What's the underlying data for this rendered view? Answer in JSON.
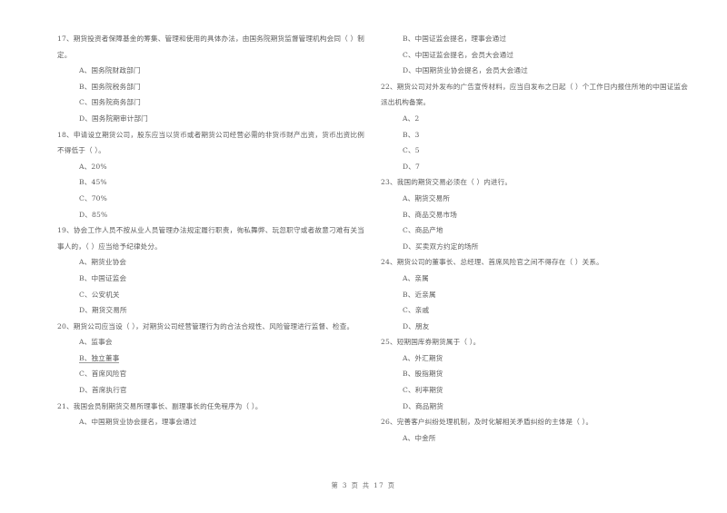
{
  "document": {
    "page_footer": "第 3 页 共 17 页",
    "page_number": "3",
    "total_pages": "17"
  },
  "columns": [
    {
      "id": "left-column",
      "questions": [
        {
          "number": "17",
          "stem": "17、期货投资者保障基金的筹集、管理和使用的具体办法，由国务院期货监督管理机构会同（    ）制定。",
          "options": [
            {
              "label": "A、国务院财政部门",
              "underlined": false
            },
            {
              "label": "B、国务院税务部门",
              "underlined": false
            },
            {
              "label": "C、国务院商务部门",
              "underlined": false
            },
            {
              "label": "D、国务院期审计部门",
              "underlined": false
            }
          ]
        },
        {
          "number": "18",
          "stem": "18、申请设立期货公司，股东应当以货币或者期货公司经营必需的非货币财产出资，货币出资比例不得低于（    ）。",
          "options": [
            {
              "label": "A、20%",
              "underlined": false
            },
            {
              "label": "B、45%",
              "underlined": false
            },
            {
              "label": "C、70%",
              "underlined": false
            },
            {
              "label": "D、85%",
              "underlined": false
            }
          ]
        },
        {
          "number": "19",
          "stem": "19、协会工作人员不按从业人员管理办法规定履行职责，徇私舞弊、玩忽职守或者故意刁难有关当事人的，（    ）应当给予纪律处分。",
          "options": [
            {
              "label": "A、期货业协会",
              "underlined": false
            },
            {
              "label": "B、中国证监会",
              "underlined": false
            },
            {
              "label": "C、公安机关",
              "underlined": false
            },
            {
              "label": "D、期货交易所",
              "underlined": false
            }
          ]
        },
        {
          "number": "20",
          "stem": "20、期货公司应当设（    ），对期货公司经营管理行为的合法合规性、风险管理进行监督、检查。",
          "options": [
            {
              "label": "A、监事会",
              "underlined": false
            },
            {
              "label": "B、独立董事",
              "underlined": true
            },
            {
              "label": "C、首席风险官",
              "underlined": false
            },
            {
              "label": "D、首席执行官",
              "underlined": false
            }
          ]
        },
        {
          "number": "21",
          "stem": "21、我国会员制期货交易所理事长、副理事长的任免程序为（    ）。",
          "options": [
            {
              "label": "A、中国期货业协会提名，理事会通过",
              "underlined": false
            }
          ]
        }
      ]
    },
    {
      "id": "right-column",
      "questions": [
        {
          "number": "21-cont",
          "stem": "",
          "options": [
            {
              "label": "B、中国证监会提名，理事会通过",
              "underlined": false
            },
            {
              "label": "C、中国证监会提名，会员大会通过",
              "underlined": false
            },
            {
              "label": "D、中国期货业协会提名，会员大会通过",
              "underlined": false
            }
          ]
        },
        {
          "number": "22",
          "stem": "22、期货公司对外发布的广告宣传材料，应当自发布之日起（    ）个工作日内报住所地的中国证监会派出机构备案。",
          "options": [
            {
              "label": "A、2",
              "underlined": false
            },
            {
              "label": "B、3",
              "underlined": false
            },
            {
              "label": "C、5",
              "underlined": false
            },
            {
              "label": "D、7",
              "underlined": false
            }
          ]
        },
        {
          "number": "23",
          "stem": "23、我国的期货交易必须在（    ）内进行。",
          "options": [
            {
              "label": "A、期货交易所",
              "underlined": false
            },
            {
              "label": "B、商品交易市场",
              "underlined": false
            },
            {
              "label": "C、商品产地",
              "underlined": false
            },
            {
              "label": "D、买卖双方约定的场所",
              "underlined": false
            }
          ]
        },
        {
          "number": "24",
          "stem": "24、期货公司的董事长、总经理、首席风险官之间不得存在（    ）关系。",
          "options": [
            {
              "label": "A、亲属",
              "underlined": false
            },
            {
              "label": "B、近亲属",
              "underlined": false
            },
            {
              "label": "C、亲戚",
              "underlined": false
            },
            {
              "label": "D、朋友",
              "underlined": false
            }
          ]
        },
        {
          "number": "25",
          "stem": "25、短期国库券期货属于（    ）。",
          "options": [
            {
              "label": "A、外汇期货",
              "underlined": false
            },
            {
              "label": "B、股指期货",
              "underlined": false
            },
            {
              "label": "C、利率期货",
              "underlined": false
            },
            {
              "label": "D、商品期货",
              "underlined": false
            }
          ]
        },
        {
          "number": "26",
          "stem": "26、完善客户纠纷处理机制，及时化解相关矛盾纠纷的主体是（    ）。",
          "options": [
            {
              "label": "A、中金所",
              "underlined": false
            }
          ]
        }
      ]
    }
  ]
}
